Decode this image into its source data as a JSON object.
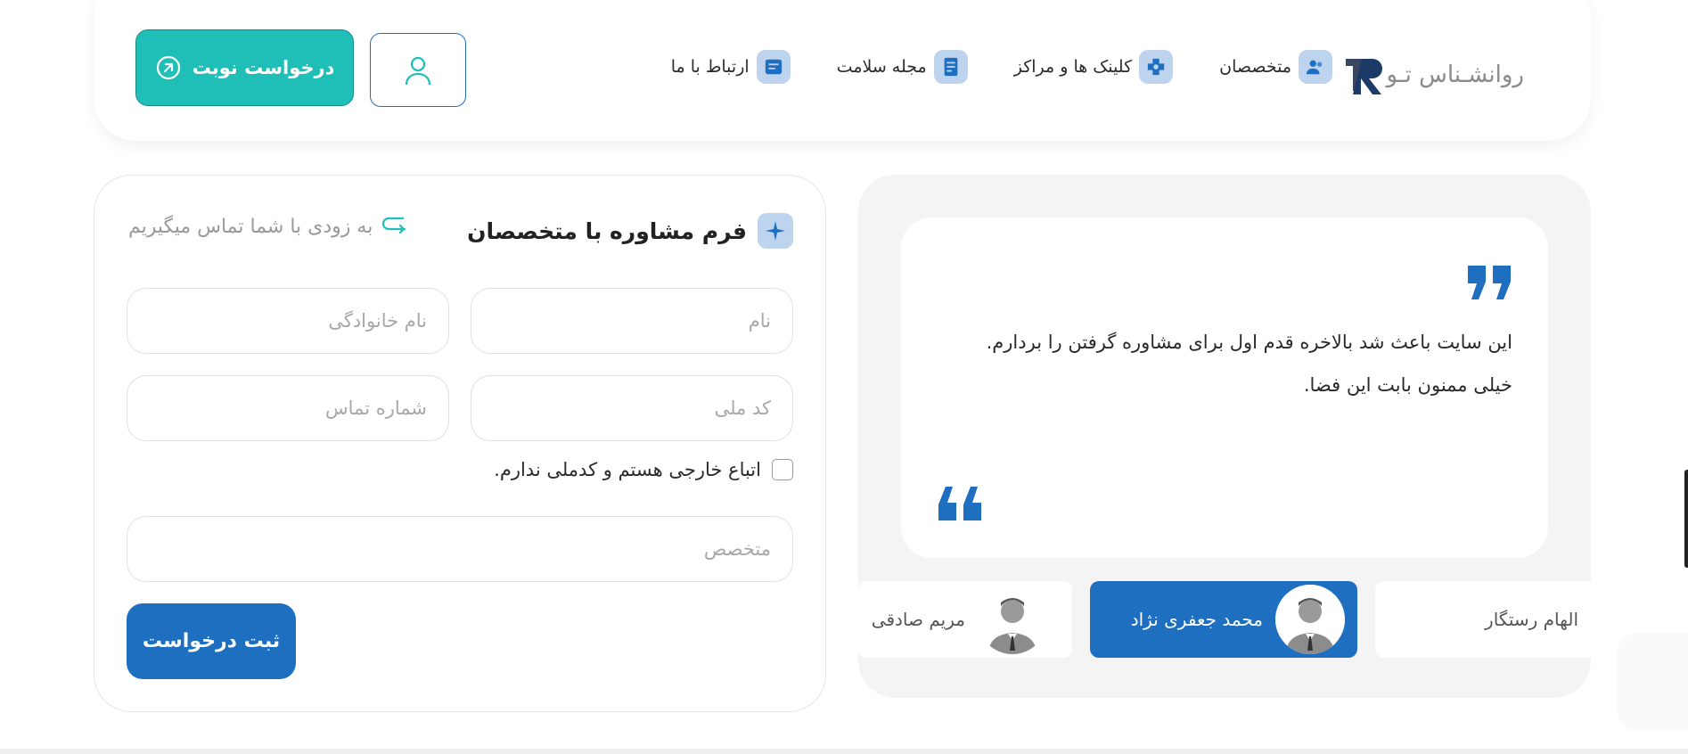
{
  "header": {
    "logo_text": "روانشـناس تـو",
    "nav": [
      {
        "label": "متخصصان",
        "icon": "users-icon"
      },
      {
        "label": "کلینک ها و مراکز",
        "icon": "clinic-icon"
      },
      {
        "label": "مجله سلامت",
        "icon": "magazine-icon"
      },
      {
        "label": "ارتباط با ما",
        "icon": "contact-icon"
      }
    ],
    "user_icon": "user-icon",
    "appointment_label": "درخواست نوبت"
  },
  "form": {
    "title": "فرم مشاوره با متخصصان",
    "subtitle": "به زودی با شما تماس میگیریم",
    "first_name_placeholder": "نام",
    "last_name_placeholder": "نام خانوادگی",
    "national_code_placeholder": "کد ملی",
    "phone_placeholder": "شماره تماس",
    "foreign_checkbox_label": "اتباع خارجی هستم و کدملی ندارم.",
    "foreign_checked": false,
    "specialist_placeholder": "متخصص",
    "submit_label": "ثبت درخواست"
  },
  "testimonial": {
    "line1": "این سایت باعث شد بالاخره قدم اول برای مشاوره گرفتن را بردارم.",
    "line2": "خیلی ممنون بابت این فضا.",
    "people": [
      {
        "name": "الهام رستگار",
        "active": false
      },
      {
        "name": "محمد جعفری نژاد",
        "active": true
      },
      {
        "name": "مریم صادقی",
        "active": false
      }
    ]
  },
  "colors": {
    "primary": "#1e6fbf",
    "accent": "#1fbfb8",
    "icon_bg": "#bdd3ee"
  }
}
